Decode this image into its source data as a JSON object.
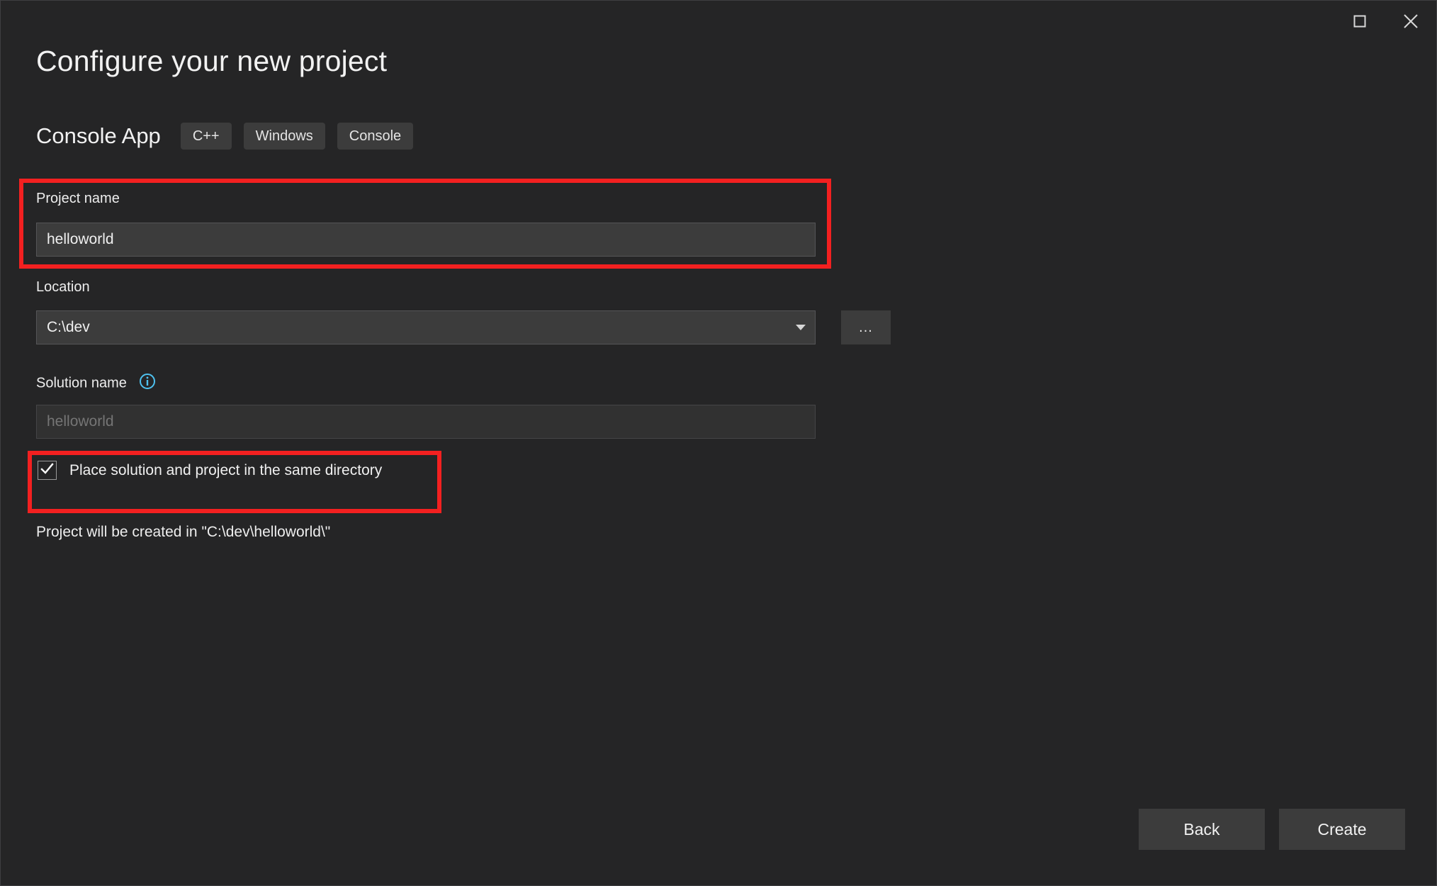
{
  "window": {
    "maximize_label": "Maximize",
    "close_label": "Close"
  },
  "header": {
    "title": "Configure your new project",
    "template_name": "Console App",
    "tags": [
      "C++",
      "Windows",
      "Console"
    ]
  },
  "form": {
    "project_name": {
      "label": "Project name",
      "value": "helloworld",
      "placeholder": ""
    },
    "location": {
      "label": "Location",
      "value": "C:\\dev",
      "browse_label": "...",
      "dropdown_icon": "chevron-down-icon"
    },
    "solution_name": {
      "label": "Solution name",
      "info_icon": "info-icon",
      "value": "",
      "placeholder": "helloworld",
      "disabled": true
    },
    "same_directory_checkbox": {
      "label": "Place solution and project in the same directory",
      "checked": true
    },
    "created_in_text": "Project will be created in \"C:\\dev\\helloworld\\\""
  },
  "footer": {
    "back_label": "Back",
    "create_label": "Create"
  },
  "colors": {
    "background": "#252526",
    "field_background": "#3c3c3c",
    "highlight": "#f32020",
    "info_accent": "#4ec2f0",
    "text": "#f2f2f2"
  }
}
